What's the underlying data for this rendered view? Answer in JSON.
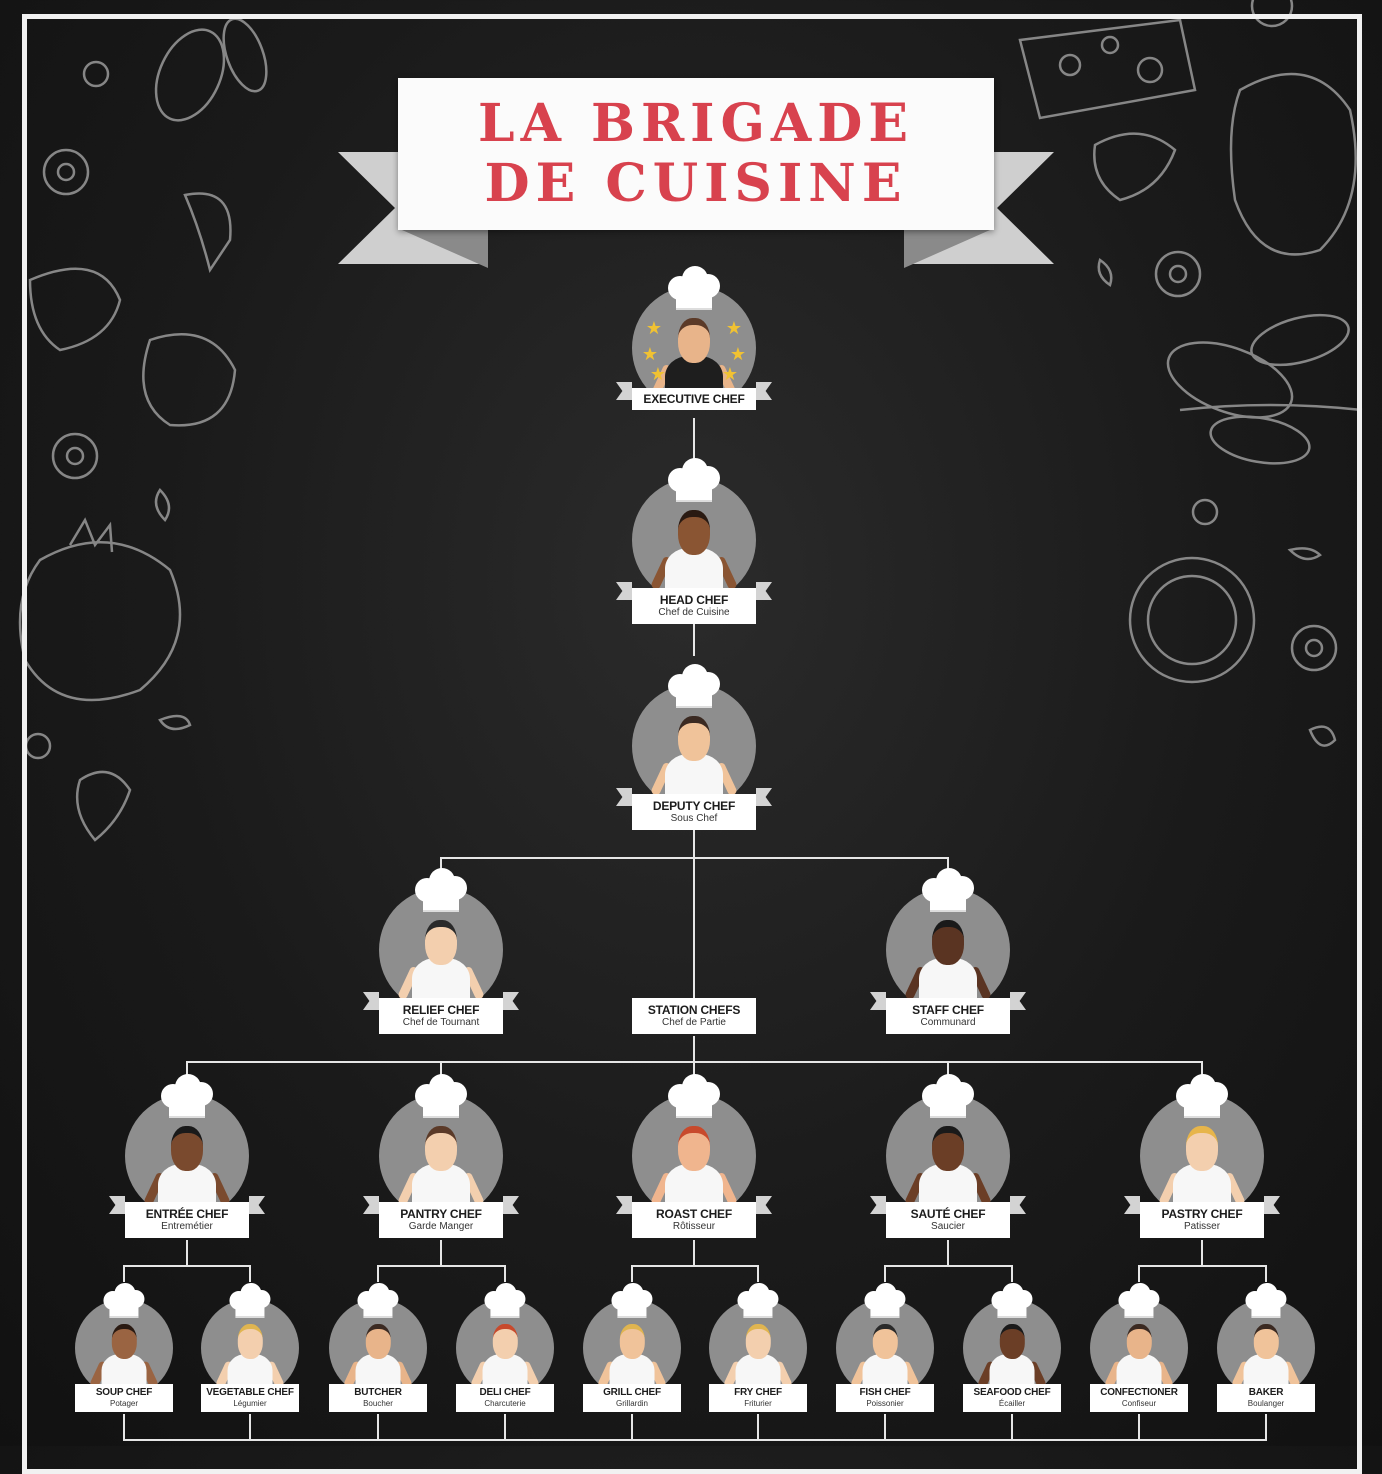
{
  "title": {
    "line1": "LA BRIGADE",
    "line2": "DE CUISINE"
  },
  "colors": {
    "background": "#1b1b1b",
    "title_red": "#d8424e",
    "circle": "#8e8e8e",
    "line": "#e6e6e6"
  },
  "chefs": {
    "executive": {
      "title": "EXECUTIVE CHEF",
      "subtitle": ""
    },
    "head": {
      "title": "HEAD CHEF",
      "subtitle": "Chef de Cuisine"
    },
    "deputy": {
      "title": "DEPUTY CHEF",
      "subtitle": "Sous Chef"
    },
    "relief": {
      "title": "RELIEF CHEF",
      "subtitle": "Chef de Tournant"
    },
    "station": {
      "title": "STATION CHEFS",
      "subtitle": "Chef de Partie"
    },
    "staff": {
      "title": "STAFF CHEF",
      "subtitle": "Communard"
    },
    "entree": {
      "title": "ENTRÉE CHEF",
      "subtitle": "Entremétier"
    },
    "pantry": {
      "title": "PANTRY CHEF",
      "subtitle": "Garde Manger"
    },
    "roast": {
      "title": "ROAST CHEF",
      "subtitle": "Rôtisseur"
    },
    "saute": {
      "title": "SAUTÉ CHEF",
      "subtitle": "Saucier"
    },
    "pastry": {
      "title": "PASTRY CHEF",
      "subtitle": "Patisser"
    },
    "soup": {
      "title": "SOUP CHEF",
      "subtitle": "Potager"
    },
    "vegetable": {
      "title": "VEGETABLE CHEF",
      "subtitle": "Légumier"
    },
    "butcher": {
      "title": "BUTCHER",
      "subtitle": "Boucher"
    },
    "deli": {
      "title": "DELI CHEF",
      "subtitle": "Charcuterie"
    },
    "grill": {
      "title": "GRILL CHEF",
      "subtitle": "Grillardin"
    },
    "fry": {
      "title": "FRY CHEF",
      "subtitle": "Friturier"
    },
    "fish": {
      "title": "FISH CHEF",
      "subtitle": "Poissonier"
    },
    "seafood": {
      "title": "SEAFOOD CHEF",
      "subtitle": "Écailler"
    },
    "confectioner": {
      "title": "CONFECTIONER",
      "subtitle": "Confiseur"
    },
    "baker": {
      "title": "BAKER",
      "subtitle": "Boulanger"
    }
  }
}
